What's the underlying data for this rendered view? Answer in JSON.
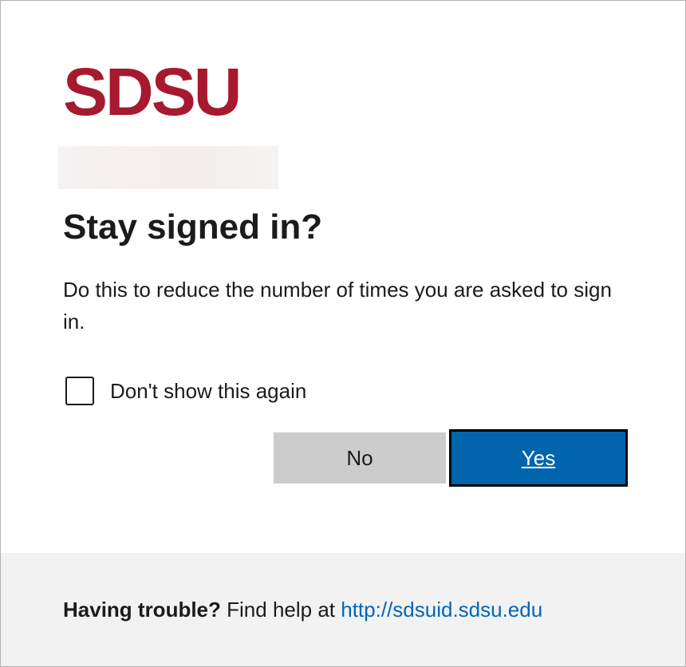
{
  "brand": {
    "logo_text": "SDSU",
    "logo_color": "#a6192e"
  },
  "dialog": {
    "title": "Stay signed in?",
    "description": "Do this to reduce the number of times you are asked to sign in.",
    "checkbox": {
      "label": "Don't show this again",
      "checked": false
    },
    "buttons": {
      "no_label": "No",
      "yes_label": "Yes"
    },
    "colors": {
      "primary": "#0164ac",
      "secondary": "#cccccc"
    }
  },
  "footer": {
    "trouble_label": "Having trouble?",
    "help_text": "Find help at",
    "help_link": "http://sdsuid.sdsu.edu",
    "link_color": "#0067b8"
  }
}
